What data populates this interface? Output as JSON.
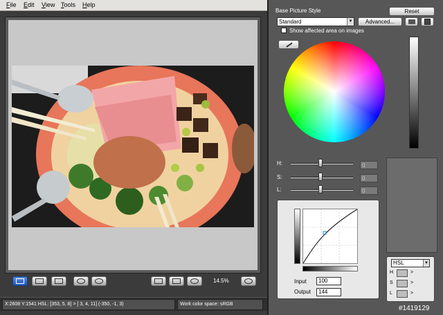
{
  "menubar": {
    "file": {
      "key": "F",
      "rest": "ile"
    },
    "edit": {
      "key": "E",
      "rest": "dit"
    },
    "view": {
      "key": "V",
      "rest": "iew"
    },
    "tools": {
      "key": "T",
      "rest": "ools"
    },
    "help": {
      "key": "H",
      "rest": "elp"
    }
  },
  "viewer": {
    "zoom": "14.5%",
    "photo_description_icon": "food-photo"
  },
  "status": {
    "left": "X:2608 Y:1541  HSL: [353,  5,  8] > [  3,  4, 11]  (-350, -1,  3)",
    "right": "Work color space: sRGB"
  },
  "panel": {
    "base_picture_style_label": "Base Picture Style",
    "reset_label": "Reset",
    "style_value": "Standard",
    "advanced_label": "Advanced...",
    "show_affected_label": "Show affected area on images",
    "sliders": [
      {
        "label": "H:",
        "value": "0"
      },
      {
        "label": "S:",
        "value": "0"
      },
      {
        "label": "L:",
        "value": "0"
      }
    ],
    "curve": {
      "input_label": "Input",
      "input_value": "100",
      "output_label": "Output",
      "output_value": "144"
    },
    "hsl": {
      "mode": "HSL",
      "rows": [
        {
          "label": "H",
          "arrow": ">"
        },
        {
          "label": "S",
          "arrow": ">"
        },
        {
          "label": "L",
          "arrow": ">"
        }
      ]
    }
  },
  "watermark": "#1419129",
  "colors": {
    "accent_active": "#1e54b8",
    "panel_bg": "#575757",
    "plate_rim": "#e8765a"
  }
}
